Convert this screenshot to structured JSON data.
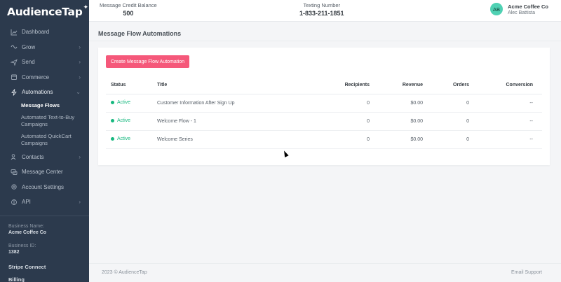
{
  "brand": {
    "name": "AudienceTap"
  },
  "topbar": {
    "credit_label": "Message Credit Balance",
    "credit_value": "500",
    "texting_label": "Texting Number",
    "texting_value": "1-833-211-1851",
    "avatar_initials": "AB",
    "org_name": "Acme Coffee Co",
    "user_name": "Alec Battista"
  },
  "sidebar": {
    "items": [
      {
        "label": "Dashboard",
        "icon": "chart-icon"
      },
      {
        "label": "Grow",
        "icon": "grow-icon"
      },
      {
        "label": "Send",
        "icon": "send-icon"
      },
      {
        "label": "Commerce",
        "icon": "cart-icon"
      },
      {
        "label": "Automations",
        "icon": "bolt-icon"
      },
      {
        "label": "Contacts",
        "icon": "contacts-icon"
      },
      {
        "label": "Message Center",
        "icon": "chat-icon"
      },
      {
        "label": "Account Settings",
        "icon": "gear-icon"
      },
      {
        "label": "API",
        "icon": "api-icon"
      }
    ],
    "sub_items": [
      "Message Flows",
      "Automated Text-to-Buy Campaigns",
      "Automated QuickCart Campaigns"
    ],
    "business_name_label": "Business Name:",
    "business_name": "Acme Coffee Co",
    "business_id_label": "Business ID:",
    "business_id": "1382",
    "stripe_label": "Stripe Connect",
    "billing_label": "Billing"
  },
  "main": {
    "title": "Message Flow Automations",
    "create_button": "Create Message Flow Automation",
    "columns": [
      "Status",
      "Title",
      "Recipients",
      "Revenue",
      "Orders",
      "Conversion"
    ],
    "rows": [
      {
        "status": "Active",
        "title": "Customer Information After Sign Up",
        "recipients": "0",
        "revenue": "$0.00",
        "orders": "0",
        "conversion": "--"
      },
      {
        "status": "Active",
        "title": "Welcome Flow - 1",
        "recipients": "0",
        "revenue": "$0.00",
        "orders": "0",
        "conversion": "--"
      },
      {
        "status": "Active",
        "title": "Welcome Series",
        "recipients": "0",
        "revenue": "$0.00",
        "orders": "0",
        "conversion": "--"
      }
    ]
  },
  "footer": {
    "copyright": "2023 © AudienceTap",
    "support": "Email Support"
  },
  "colors": {
    "sidebar_bg": "#2c3a4d",
    "accent_pink": "#f5587a",
    "active_green": "#16b87f",
    "avatar_teal": "#4fd1b3"
  }
}
